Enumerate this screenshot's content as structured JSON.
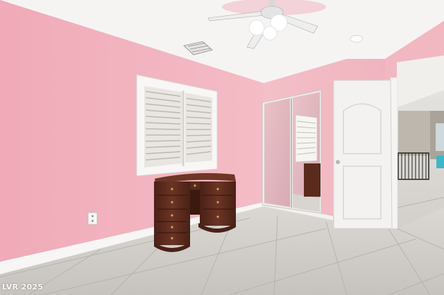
{
  "watermark": "LVR 2025",
  "colors": {
    "wall_left": "#f2b3bf",
    "wall_back": "#f1bcc4",
    "ceiling": "#f6f4f3",
    "floor": "#cfccc8",
    "trim": "#f7f6f4",
    "wood": "#5a2a1c",
    "door": "#f3f2f0"
  }
}
